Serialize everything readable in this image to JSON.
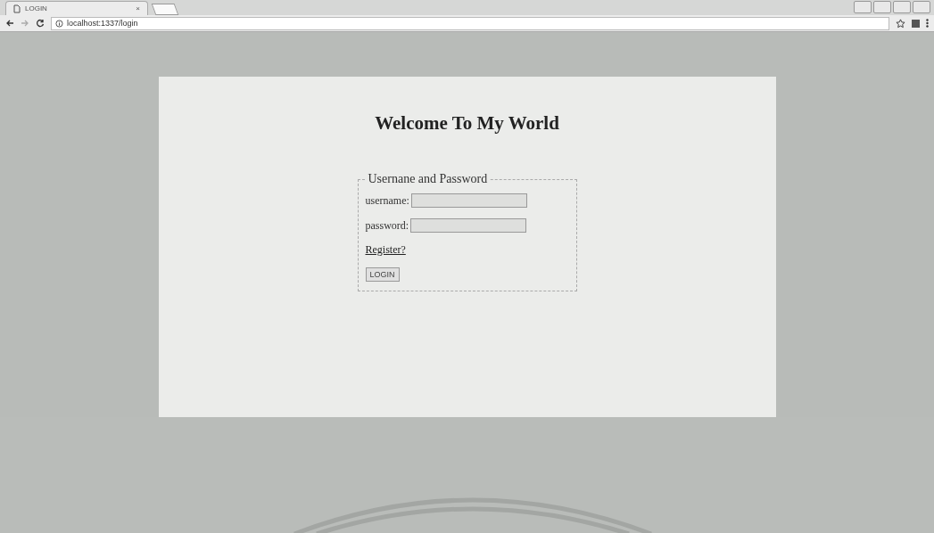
{
  "browser": {
    "tab": {
      "title": "LOGIN",
      "close": "×"
    },
    "address": "localhost:1337/login"
  },
  "page": {
    "heading": "Welcome To My World",
    "form": {
      "legend": "Usernane and Password",
      "fields": [
        {
          "label": "username:"
        },
        {
          "label": "password:"
        }
      ],
      "link": "Register?",
      "button": "LOGIN"
    }
  }
}
